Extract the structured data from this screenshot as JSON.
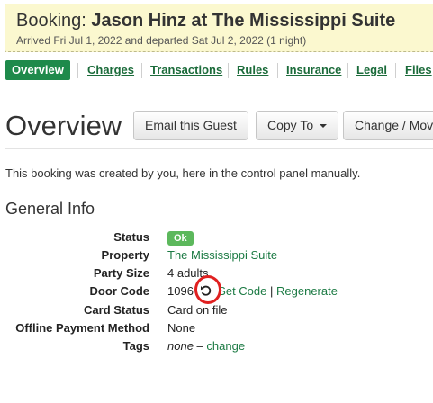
{
  "booking": {
    "title_prefix": "Booking:",
    "title_name": "Jason Hinz at The Mississippi Suite",
    "subtitle": "Arrived Fri Jul 1, 2022 and departed Sat Jul 2, 2022 (1 night)"
  },
  "tabs": [
    {
      "label": "Overview",
      "active": true
    },
    {
      "label": "Charges"
    },
    {
      "label": "Transactions"
    },
    {
      "label": "Rules"
    },
    {
      "label": "Insurance"
    },
    {
      "label": "Legal"
    },
    {
      "label": "Files"
    }
  ],
  "page": {
    "title": "Overview",
    "intro": "This booking was created by you, here in the control panel manually."
  },
  "buttons": {
    "email": "Email this Guest",
    "copy": "Copy To",
    "change": "Change / Mov"
  },
  "general": {
    "title": "General Info",
    "status_label": "Status",
    "status_value": "Ok",
    "property_label": "Property",
    "property_value": "The Mississippi Suite",
    "party_label": "Party Size",
    "party_value": "4 adults",
    "door_label": "Door Code",
    "door_value": "1096",
    "door_reset_icon": "rotate-ccw-icon",
    "door_set": "Set Code",
    "door_sep": "|",
    "door_regen": "Regenerate",
    "card_label": "Card Status",
    "card_value": "Card on file",
    "offline_label": "Offline Payment Method",
    "offline_value": "None",
    "tags_label": "Tags",
    "tags_value": "none",
    "tags_dash": "–",
    "tags_change": "change"
  },
  "colors": {
    "accent": "#1e8a4b",
    "link": "#1b7a43",
    "header_bg": "#fbf8cf",
    "badge_ok": "#5cb85c",
    "annotation": "#e02020"
  }
}
